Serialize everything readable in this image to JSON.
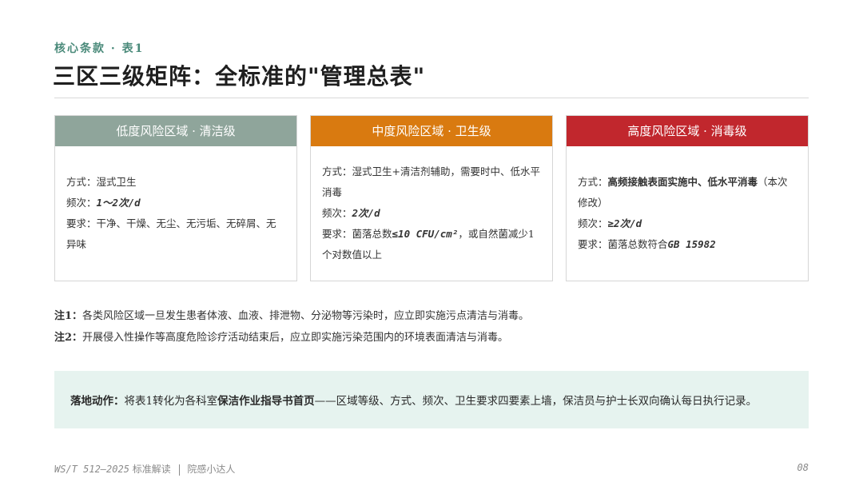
{
  "header": {
    "kicker": "核心条款 · 表1",
    "title": "三区三级矩阵：全标准的\"管理总表\""
  },
  "cards": [
    {
      "title": "低度风险区域 · 清洁级",
      "method_label": "方式：",
      "method": "湿式卫生",
      "freq_label": "频次：",
      "freq": "1～2次/d",
      "req_label": "要求：",
      "req": "干净、干燥、无尘、无污垢、无碎屑、无异味"
    },
    {
      "title": "中度风险区域 · 卫生级",
      "method_label": "方式：",
      "method": "湿式卫生+清洁剂辅助，需要时中、低水平消毒",
      "freq_label": "频次：",
      "freq": "2次/d",
      "req_label": "要求：",
      "req_pre": "菌落总数",
      "req_val": "≤10 CFU/cm²",
      "req_post": "，或自然菌减少1个对数值以上"
    },
    {
      "title": "高度风险区域 · 消毒级",
      "method_label": "方式：",
      "method_bold": "高频接触表面实施中、低水平消毒",
      "method_post": "（本次修改）",
      "freq_label": "频次：",
      "freq": "≥2次/d",
      "req_label": "要求：",
      "req_pre": "菌落总数符合",
      "req_val": "GB 15982"
    }
  ],
  "notes": [
    {
      "label": "注1：",
      "text": "各类风险区域一旦发生患者体液、血液、排泄物、分泌物等污染时，应立即实施污点清洁与消毒。"
    },
    {
      "label": "注2：",
      "text": "开展侵入性操作等高度危险诊疗活动结束后，应立即实施污染范围内的环境表面清洁与消毒。"
    }
  ],
  "action": {
    "label": "落地动作：",
    "pre": "将表1转化为各科室",
    "bold": "保洁作业指导书首页",
    "post": "——区域等级、方式、频次、卫生要求四要素上墙，保洁员与护士长双向确认每日执行记录。"
  },
  "footer": {
    "standard": "WS/T 512—2025",
    "label": "标准解读",
    "author": "院感小达人",
    "page": "08"
  },
  "colors": {
    "low": "#8fa59b",
    "mid": "#d97a10",
    "high": "#c1272d",
    "accent": "#4a8a7a",
    "action_bg": "#e6f3ef"
  }
}
